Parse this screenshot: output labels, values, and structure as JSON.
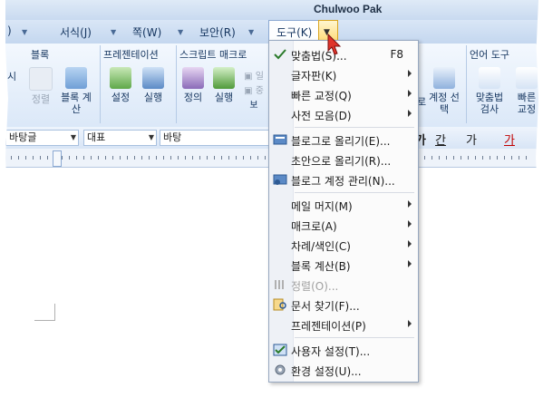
{
  "window": {
    "title": "Chulwoo Pak"
  },
  "tabs": [
    {
      "label": ")"
    },
    {
      "label": "서식(J)"
    },
    {
      "label": "쪽(W)"
    },
    {
      "label": "보안(R)"
    },
    {
      "label": "도구(K)",
      "active": true
    }
  ],
  "ribbon": {
    "groups": {
      "block": "블록",
      "present": "프레젠테이션",
      "script": "스크립트 매크로",
      "lang": "언어 도구"
    },
    "buttons": {
      "partial_left": "시",
      "sort": "정렬",
      "block_calc": "블록 계산",
      "setup": "설정",
      "run": "실행",
      "define": "정의",
      "run2": "실행",
      "partial_bo": "보",
      "partial_ro": "로",
      "account": "계정 선택",
      "spell": "맞춤법 검사",
      "partial_bba": "빠른 교정"
    }
  },
  "format_bar": {
    "style": "바탕글",
    "lang_font": "대표",
    "font": "바탕",
    "right_glyphs": [
      "가",
      "간",
      "가",
      "가"
    ]
  },
  "menu": {
    "items": [
      {
        "label": "맞춤법(S)...",
        "shortcut": "F8",
        "icon": "spellcheck-icon"
      },
      {
        "label": "글자판(K)",
        "submenu": true
      },
      {
        "label": "빠른 교정(Q)",
        "submenu": true
      },
      {
        "label": "사전 모음(D)",
        "submenu": true
      },
      {
        "label": "블로그로 올리기(E)...",
        "icon": "blog-upload-icon"
      },
      {
        "label": "초안으로 올리기(R)..."
      },
      {
        "label": "블로그 계정 관리(N)...",
        "icon": "blog-account-icon"
      },
      {
        "label": "메일 머지(M)",
        "submenu": true
      },
      {
        "label": "매크로(A)",
        "submenu": true
      },
      {
        "label": "차례/색인(C)",
        "submenu": true
      },
      {
        "label": "블록 계산(B)",
        "submenu": true
      },
      {
        "label": "정렬(O)...",
        "disabled": true,
        "icon": "sort-icon"
      },
      {
        "label": "문서 찾기(F)...",
        "icon": "find-doc-icon"
      },
      {
        "label": "프레젠테이션(P)",
        "submenu": true
      },
      {
        "label": "사용자 설정(T)...",
        "icon": "user-settings-icon"
      },
      {
        "label": "환경 설정(U)...",
        "icon": "gear-icon"
      }
    ]
  },
  "colors": {
    "accent": "#c9daf0",
    "menu_bg": "#fbfbfb",
    "highlight": "#ffd86b"
  }
}
